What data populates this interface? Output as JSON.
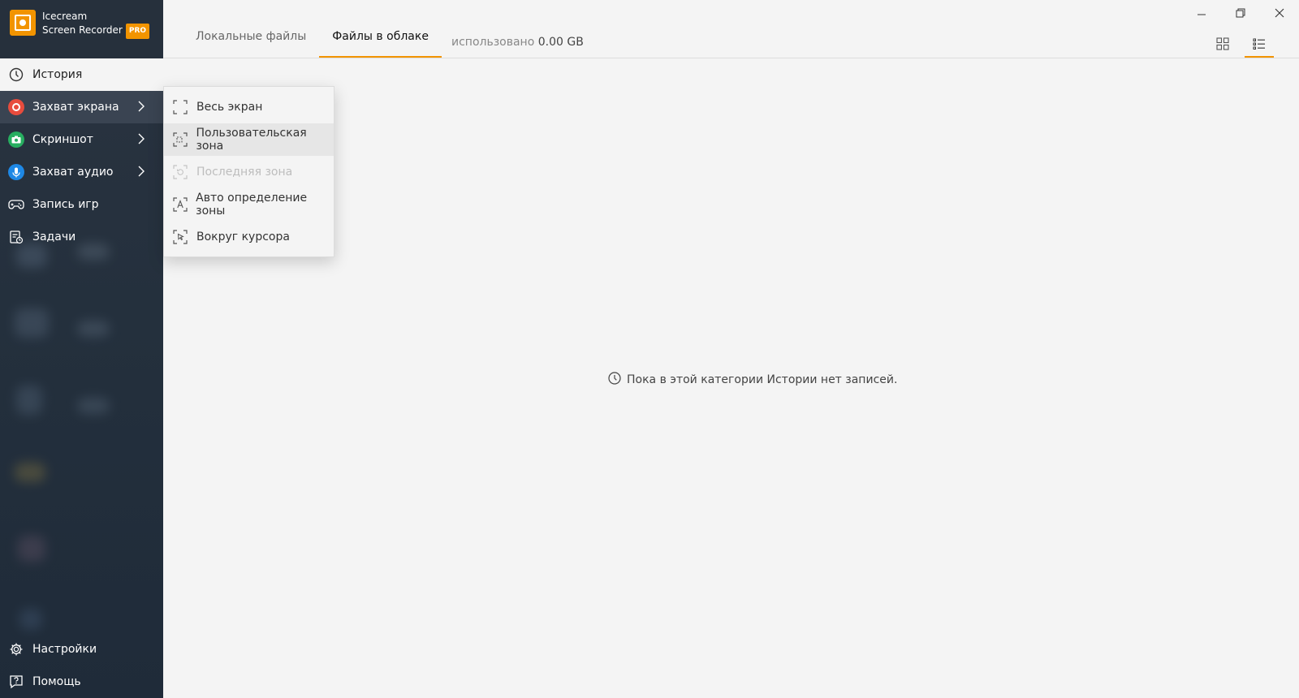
{
  "app": {
    "name_line1": "Icecream",
    "name_line2": "Screen Recorder",
    "badge": "PRO",
    "accent": "#f29400"
  },
  "sidebar": {
    "items": [
      {
        "label": "История",
        "icon": "clock-icon"
      },
      {
        "label": "Захват экрана",
        "icon": "record-icon",
        "icon_color": "#e84c3d"
      },
      {
        "label": "Скриншот",
        "icon": "camera-icon",
        "icon_color": "#27ae60"
      },
      {
        "label": "Захват аудио",
        "icon": "microphone-icon",
        "icon_color": "#1e88e5"
      },
      {
        "label": "Запись игр",
        "icon": "gamepad-icon"
      },
      {
        "label": "Задачи",
        "icon": "tasks-icon"
      }
    ],
    "bottom_items": [
      {
        "label": "Настройки",
        "icon": "gear-icon"
      },
      {
        "label": "Помощь",
        "icon": "help-icon"
      }
    ]
  },
  "header": {
    "tabs": [
      {
        "label": "Локальные файлы"
      },
      {
        "label": "Файлы в облаке"
      }
    ],
    "usage_label": "использовано",
    "usage_value": "0.00 GB"
  },
  "submenu": {
    "items": [
      {
        "label": "Весь экран",
        "icon": "fullscreen-icon"
      },
      {
        "label": "Пользовательская зона",
        "icon": "custom-area-icon"
      },
      {
        "label": "Последняя зона",
        "icon": "last-area-icon",
        "disabled": true
      },
      {
        "label": "Авто определение зоны",
        "icon": "auto-detect-icon"
      },
      {
        "label": "Вокруг курсора",
        "icon": "cursor-area-icon"
      }
    ]
  },
  "empty_state": {
    "message": "Пока в этой категории Истории нет записей."
  }
}
